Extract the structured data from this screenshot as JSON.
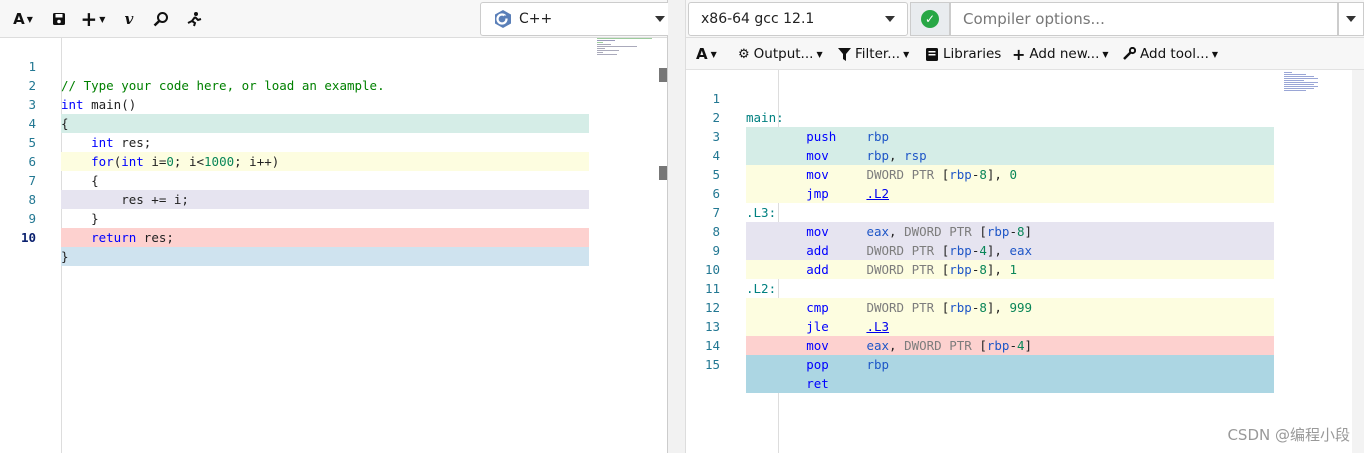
{
  "left_toolbar": {
    "font_label": "A",
    "save_icon": "save-icon",
    "add_label": "+",
    "vim_label": "v",
    "search_icon": "search-icon",
    "run_icon": "runner-icon"
  },
  "language": {
    "label": "C++",
    "logo": "cpp-logo-icon"
  },
  "source": {
    "lines": [
      {
        "n": "1",
        "text": "// Type your code here, or load an example."
      },
      {
        "n": "2",
        "text": "int main()"
      },
      {
        "n": "3",
        "text": "{"
      },
      {
        "n": "4",
        "text": "    int res;"
      },
      {
        "n": "5",
        "text": "    for(int i=0; i<1000; i++)"
      },
      {
        "n": "6",
        "text": "    {"
      },
      {
        "n": "7",
        "text": "        res += i;"
      },
      {
        "n": "8",
        "text": "    }"
      },
      {
        "n": "9",
        "text": "    return res;"
      },
      {
        "n": "10",
        "text": "}"
      }
    ]
  },
  "compiler": {
    "name": "x86-64 gcc 12.1",
    "status": "ok",
    "options_placeholder": "Compiler options..."
  },
  "output_toolbar": {
    "font_label": "A",
    "output_label": "Output...",
    "filter_label": "Filter...",
    "libraries_label": "Libraries",
    "add_new_label": "Add new...",
    "add_tool_label": "Add tool..."
  },
  "assembly": {
    "lines": [
      {
        "n": "1",
        "text": "main:"
      },
      {
        "n": "2",
        "text": "push    rbp"
      },
      {
        "n": "3",
        "text": "mov     rbp, rsp"
      },
      {
        "n": "4",
        "text": "mov     DWORD PTR [rbp-8], 0"
      },
      {
        "n": "5",
        "text": "jmp     .L2"
      },
      {
        "n": "6",
        "text": ".L3:"
      },
      {
        "n": "7",
        "text": "mov     eax, DWORD PTR [rbp-8]"
      },
      {
        "n": "8",
        "text": "add     DWORD PTR [rbp-4], eax"
      },
      {
        "n": "9",
        "text": "add     DWORD PTR [rbp-8], 1"
      },
      {
        "n": "10",
        "text": ".L2:"
      },
      {
        "n": "11",
        "text": "cmp     DWORD PTR [rbp-8], 999"
      },
      {
        "n": "12",
        "text": "jle     .L3"
      },
      {
        "n": "13",
        "text": "mov     eax, DWORD PTR [rbp-4]"
      },
      {
        "n": "14",
        "text": "pop     rbp"
      },
      {
        "n": "15",
        "text": "ret"
      }
    ]
  },
  "colors": {
    "green": "#d5ede7",
    "yellow": "#fdfde0",
    "purple": "#e6e4f0",
    "red": "#fdd1cf",
    "blue": "#acd6e3"
  },
  "watermark": "CSDN @编程小段"
}
